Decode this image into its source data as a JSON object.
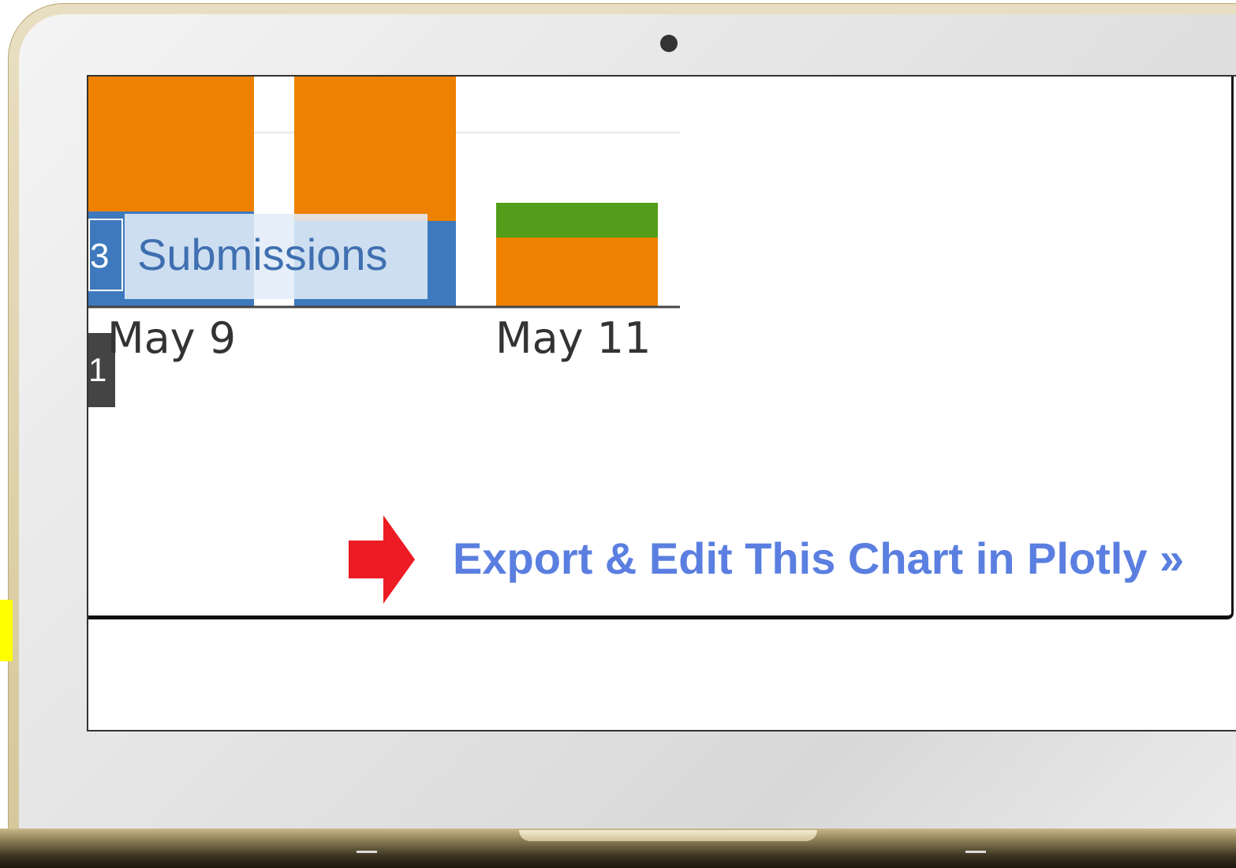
{
  "chart_data": {
    "type": "bar",
    "categories": [
      "May 9",
      "May 11"
    ],
    "x_tick_labels": [
      "May 9",
      "May 11"
    ],
    "colors": {
      "blue": "#3f79bd",
      "orange": "#ee8100",
      "green": "#529d1a"
    }
  },
  "tooltip": {
    "index_label": "3",
    "label": "Submissions"
  },
  "side_badge": {
    "label": "1"
  },
  "export": {
    "label": "Export & Edit This Chart in Plotly »",
    "arrow_icon": "arrow-right-icon",
    "arrow_color": "#ed1c24",
    "link_color": "#5a7fe0"
  }
}
